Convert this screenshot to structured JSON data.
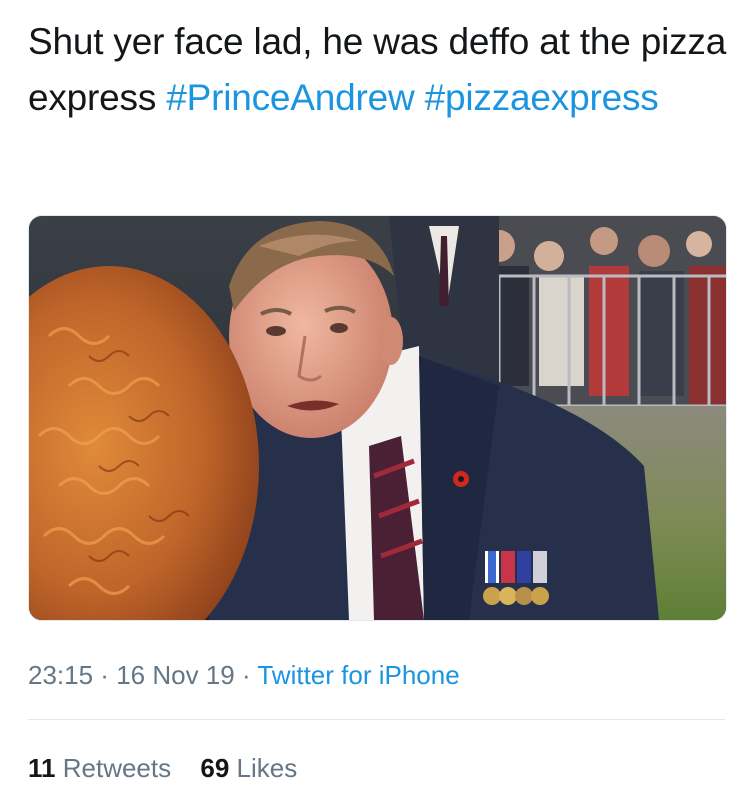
{
  "tweet": {
    "text_plain": "Shut yer face lad, he was deffo at the pizza express",
    "hashtags": [
      "#PrinceAndrew",
      "#pizzaexpress"
    ],
    "time": "23:15",
    "date": "16 Nov 19",
    "separator": " · ",
    "source": "Twitter for iPhone",
    "retweets_count": "11",
    "retweets_label": "Retweets",
    "likes_count": "69",
    "likes_label": "Likes"
  },
  "colors": {
    "link": "#1b95e0",
    "text": "#14171a",
    "muted": "#657786",
    "divider": "#e1e8ed"
  }
}
